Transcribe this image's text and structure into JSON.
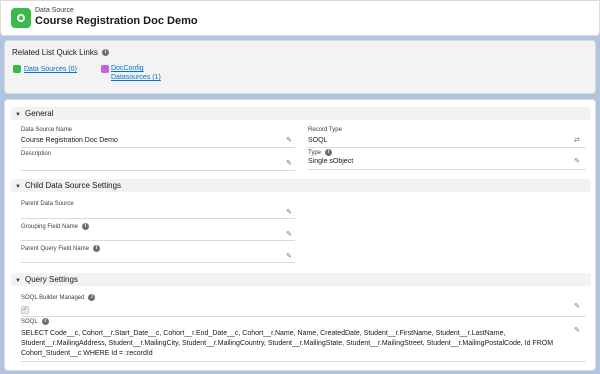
{
  "header": {
    "object_label": "Data Source",
    "record_title": "Course Registration Doc Demo",
    "icon": "data-source-icon",
    "icon_color": "#3bba4c"
  },
  "quick_links": {
    "title": "Related List Quick Links",
    "links": [
      {
        "label": "Data Sources (0)",
        "color": "#3bba4c"
      },
      {
        "label_line1": "DocConfig",
        "label_line2": "Datasources (1)",
        "color": "#c162e0"
      }
    ]
  },
  "general": {
    "title": "General",
    "data_source_name_label": "Data Source Name",
    "data_source_name_value": "Course Registration Doc Demo",
    "description_label": "Description",
    "description_value": "",
    "record_type_label": "Record Type",
    "record_type_value": "SOQL",
    "type_label": "Type",
    "type_value": "Single sObject"
  },
  "child_settings": {
    "title": "Child Data Source Settings",
    "parent_data_source_label": "Parent Data Source",
    "parent_data_source_value": "",
    "grouping_field_label": "Grouping Field Name",
    "grouping_field_value": "",
    "parent_query_field_label": "Parent Query Field Name",
    "parent_query_field_value": ""
  },
  "query_settings": {
    "title": "Query Settings",
    "soql_builder_label": "SOQL Builder Managed",
    "soql_builder_checked": true,
    "soql_label": "SOQL",
    "soql_value": "SELECT Code__c, Cohort__r.Start_Date__c, Cohort__r.End_Date__c, Cohort__r.Name, Name, CreatedDate, Student__r.FirstName, Student__r.LastName, Student__r.MailingAddress, Student__r.MailingCity, Student__r.MailingCountry, Student__r.MailingState, Student__r.MailingStreet, Student__r.MailingPostalCode, Id FROM Cohort_Student__c WHERE Id = :recordId"
  }
}
